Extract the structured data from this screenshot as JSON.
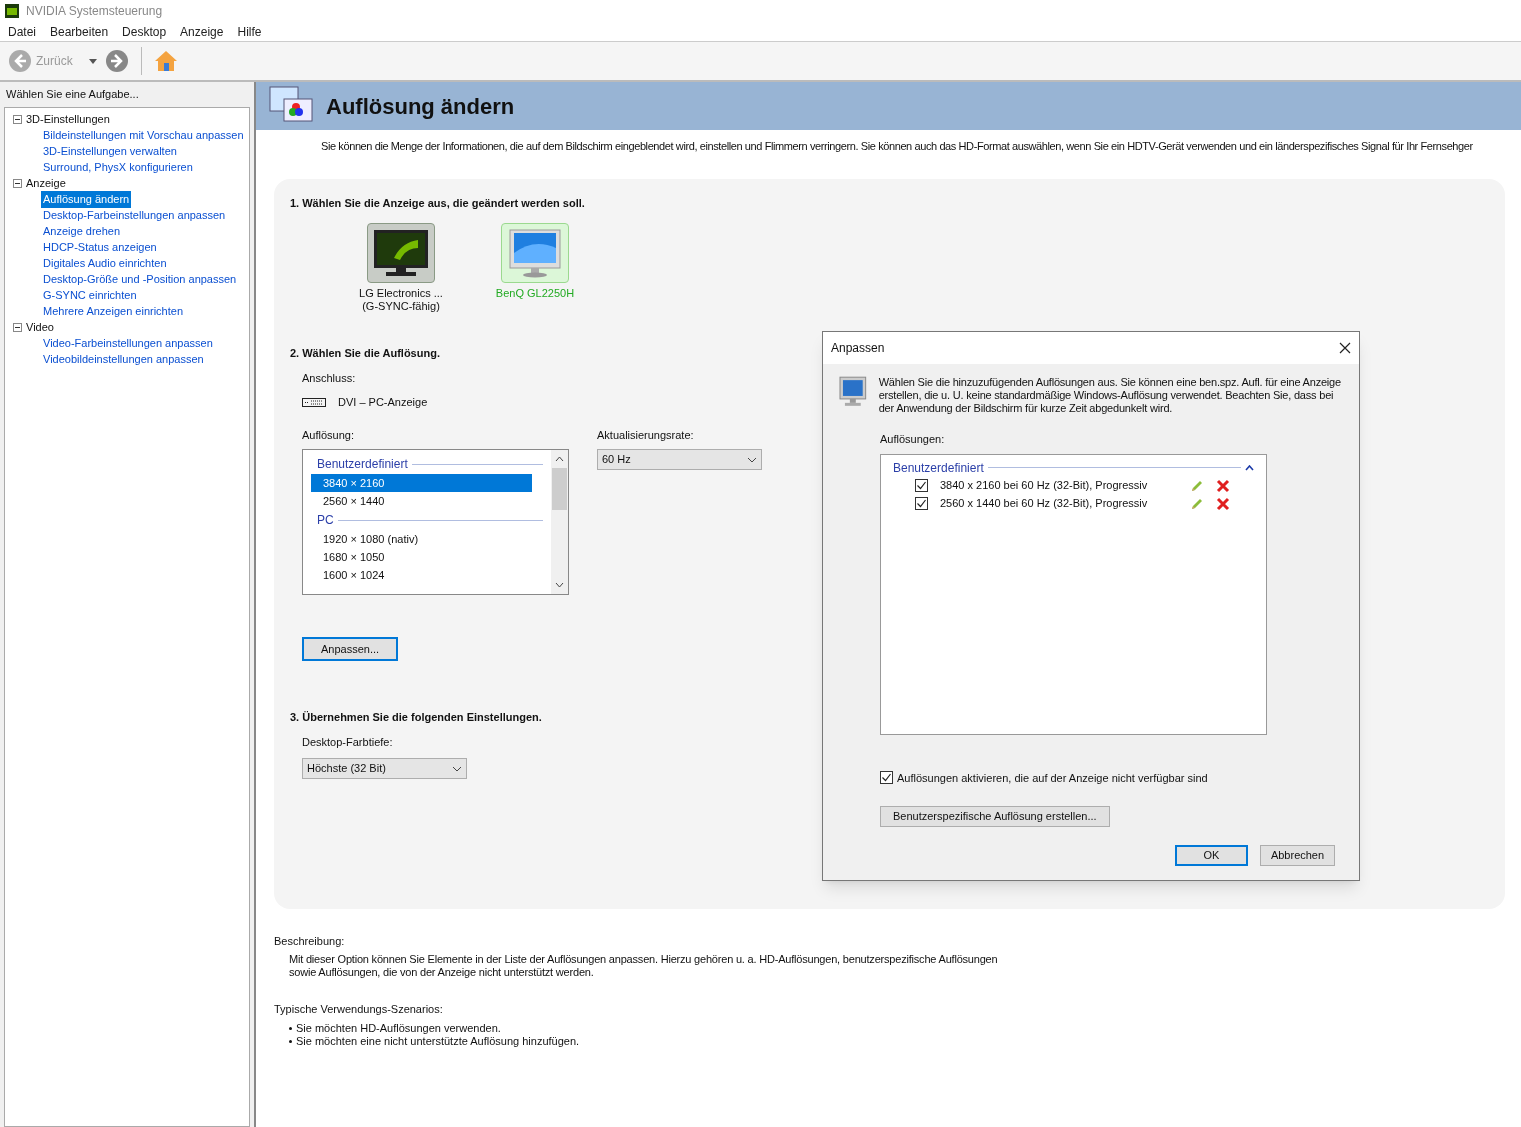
{
  "window": {
    "title": "NVIDIA Systemsteuerung"
  },
  "menu": [
    "Datei",
    "Bearbeiten",
    "Desktop",
    "Anzeige",
    "Hilfe"
  ],
  "toolbar": {
    "back_label": "Zurück",
    "back_disabled": true
  },
  "sidebar": {
    "heading": "Wählen Sie eine Aufgabe...",
    "items": [
      {
        "label": "3D-Einstellungen",
        "expanded": true,
        "selected": false,
        "children": [
          {
            "label": "Bildeinstellungen mit Vorschau anpassen",
            "selected": false
          },
          {
            "label": "3D-Einstellungen verwalten",
            "selected": false
          },
          {
            "label": "Surround, PhysX konfigurieren",
            "selected": false
          }
        ]
      },
      {
        "label": "Anzeige",
        "expanded": true,
        "selected": false,
        "children": [
          {
            "label": "Auflösung ändern",
            "selected": true
          },
          {
            "label": "Desktop-Farbeinstellungen anpassen",
            "selected": false
          },
          {
            "label": "Anzeige drehen",
            "selected": false
          },
          {
            "label": "HDCP-Status anzeigen",
            "selected": false
          },
          {
            "label": "Digitales Audio einrichten",
            "selected": false
          },
          {
            "label": "Desktop-Größe und -Position anpassen",
            "selected": false
          },
          {
            "label": "G-SYNC einrichten",
            "selected": false
          },
          {
            "label": "Mehrere Anzeigen einrichten",
            "selected": false
          }
        ]
      },
      {
        "label": "Video",
        "expanded": true,
        "selected": false,
        "children": [
          {
            "label": "Video-Farbeinstellungen anpassen",
            "selected": false
          },
          {
            "label": "Videobildeinstellungen anpassen",
            "selected": false
          }
        ]
      }
    ]
  },
  "page": {
    "title": "Auflösung ändern",
    "intro": "Sie können die Menge der Informationen, die auf dem Bildschirm eingeblendet wird, einstellen und Flimmern verringern. Sie können auch das HD-Format auswählen, wenn Sie ein HDTV-Gerät verwenden und ein länderspezifisches Signal für Ihr Fernsehger",
    "step1": {
      "heading": "1. Wählen Sie die Anzeige aus, die geändert werden soll.",
      "displays": [
        {
          "kind": "nvidia",
          "name": "LG Electronics ...",
          "note": "(G-SYNC-fähig)",
          "selected": false
        },
        {
          "kind": "desktop",
          "name": "BenQ GL2250H",
          "selected": true
        }
      ]
    },
    "step2": {
      "heading": "2. Wählen Sie die Auflösung.",
      "connector_label": "Anschluss:",
      "connector": "DVI – PC-Anzeige",
      "resolution_label": "Auflösung:",
      "resolutions": [
        {
          "kind": "group",
          "label": "Benutzerdefiniert"
        },
        {
          "kind": "item",
          "label": "3840 × 2160",
          "selected": true
        },
        {
          "kind": "item",
          "label": "2560 × 1440",
          "selected": false
        },
        {
          "kind": "group",
          "label": "PC"
        },
        {
          "kind": "item",
          "label": "1920 × 1080 (nativ)",
          "selected": false
        },
        {
          "kind": "item",
          "label": "1680 × 1050",
          "selected": false
        },
        {
          "kind": "item",
          "label": "1600 × 1024",
          "selected": false
        }
      ],
      "refresh_label": "Aktualisierungsrate:",
      "refresh": "60 Hz",
      "customize_button": "Anpassen..."
    },
    "step3": {
      "heading": "3. Übernehmen Sie die folgenden Einstellungen.",
      "depth_label": "Desktop-Farbtiefe:",
      "depth": "Höchste (32 Bit)"
    },
    "description": {
      "label": "Beschreibung:",
      "text": "Mit dieser Option können Sie Elemente in der Liste der Auflösungen anpassen. Hierzu gehören u. a. HD-Auflösungen, benutzerspezifische Auflösungen sowie Auflösungen, die von der Anzeige nicht unterstützt werden."
    },
    "scenarios": {
      "label": "Typische Verwendungs-Szenarios:",
      "items": [
        "Sie möchten HD-Auflösungen verwenden.",
        "Sie möchten eine nicht unterstützte Auflösung hinzufügen."
      ]
    }
  },
  "dialog": {
    "title": "Anpassen",
    "text": "Wählen Sie die hinzuzufügenden Auflösungen aus. Sie können eine ben.spz. Aufl. für eine Anzeige erstellen, die u. U. keine standardmäßige Windows-Auflösung verwendet. Beachten Sie, dass bei der Anwendung der Bildschirm für kurze Zeit abgedunkelt wird.",
    "list_label": "Auflösungen:",
    "group": "Benutzerdefiniert",
    "group_expanded": true,
    "rows": [
      {
        "label": "3840 x 2160 bei 60 Hz (32-Bit), Progressiv",
        "checked": true
      },
      {
        "label": "2560 x 1440 bei 60 Hz (32-Bit), Progressiv",
        "checked": true
      }
    ],
    "enable_unavailable": {
      "label": "Auflösungen aktivieren, die auf der Anzeige nicht verfügbar sind",
      "checked": true
    },
    "create_button": "Benutzerspezifische Auflösung erstellen...",
    "ok": "OK",
    "cancel": "Abbrechen"
  }
}
